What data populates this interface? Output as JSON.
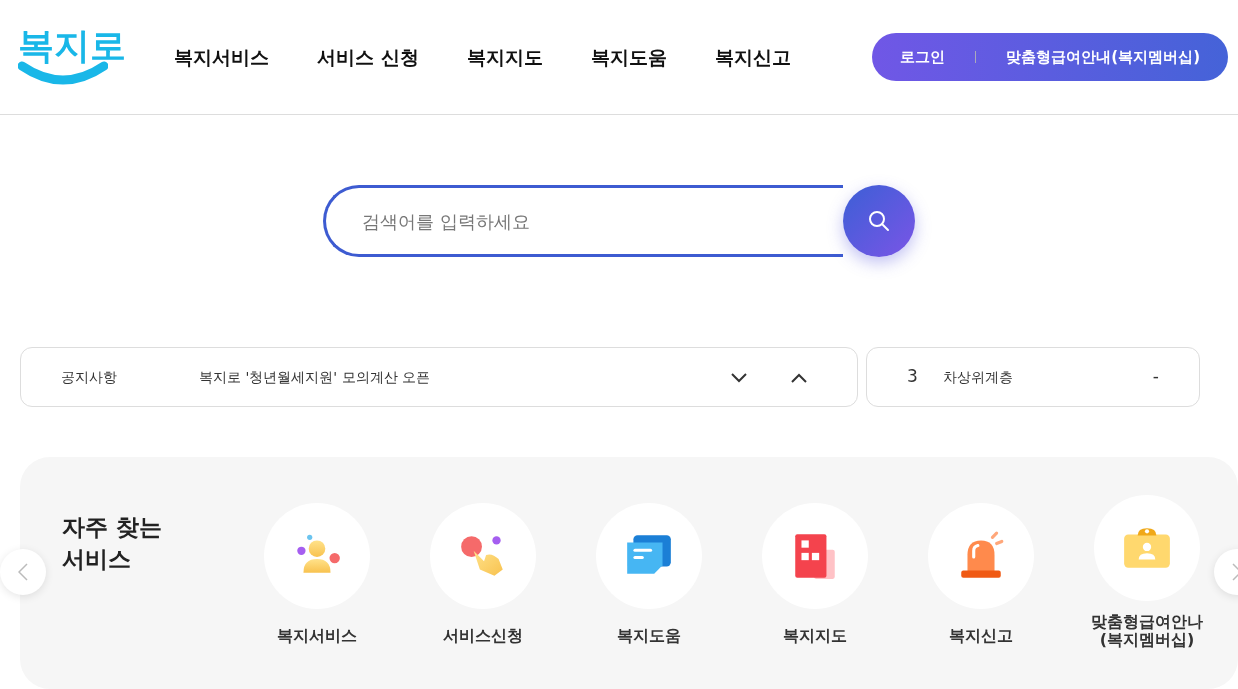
{
  "logo": "복지로",
  "nav": [
    "복지서비스",
    "서비스 신청",
    "복지지도",
    "복지도움",
    "복지신고"
  ],
  "header_buttons": [
    "로그인",
    "맞춤형급여안내(복지멤버십)"
  ],
  "search": {
    "placeholder": "검색어를 입력하세요"
  },
  "notice": {
    "label": "공지사항",
    "text": "복지로 '청년월세지원' 모의계산 오픈"
  },
  "ranking": {
    "rank": "3",
    "term": "차상위계층",
    "change": "-"
  },
  "services": {
    "title": "자주 찾는\n서비스",
    "items": [
      {
        "label": "복지서비스"
      },
      {
        "label": "서비스신청"
      },
      {
        "label": "복지도움"
      },
      {
        "label": "복지지도"
      },
      {
        "label": "복지신고"
      },
      {
        "label": "맞춤형급여안나\n(복지멤버십)"
      }
    ]
  }
}
